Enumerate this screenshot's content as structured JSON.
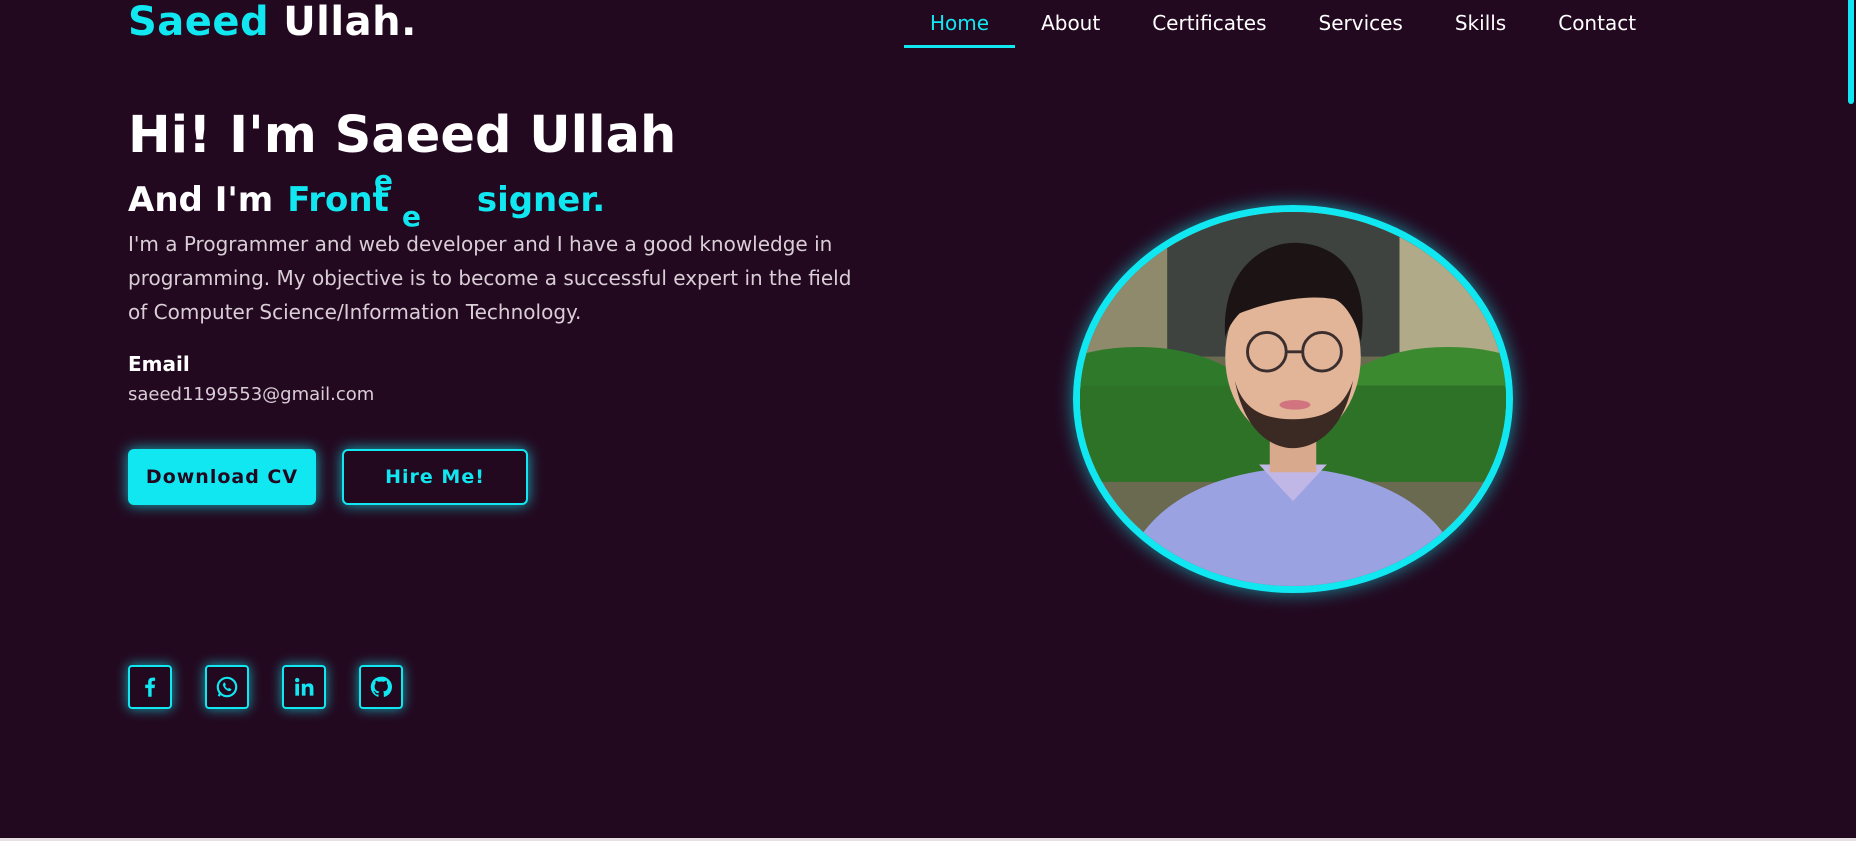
{
  "brand": {
    "first": "Saeed",
    "last": "Ullah."
  },
  "nav": {
    "items": [
      {
        "label": "Home",
        "active": true
      },
      {
        "label": "About"
      },
      {
        "label": "Certificates"
      },
      {
        "label": "Services"
      },
      {
        "label": "Skills"
      },
      {
        "label": "Contact"
      }
    ]
  },
  "hero": {
    "title": "Hi! I'm Saeed Ullah",
    "subtitle_prefix": "And I'm",
    "typed_text": "Front",
    "typed_float_1": "e",
    "typed_float_2": "e",
    "typed_suffix": "signer.",
    "bio": "I'm a Programmer and web developer and I have a good knowledge in programming. My objective is to become a successful expert in the field of Computer Science/Information Technology.",
    "email_label": "Email",
    "email_value": "saeed1199553@gmail.com"
  },
  "buttons": {
    "download": "Download CV",
    "hire": "Hire Me!"
  },
  "social": [
    {
      "icon": "facebook-icon"
    },
    {
      "icon": "whatsapp-icon"
    },
    {
      "icon": "linkedin-icon"
    },
    {
      "icon": "github-icon"
    }
  ],
  "colors": {
    "background": "#230920",
    "accent": "#11e7f0",
    "text": "#ffffff",
    "muted": "#d9cdd6"
  }
}
